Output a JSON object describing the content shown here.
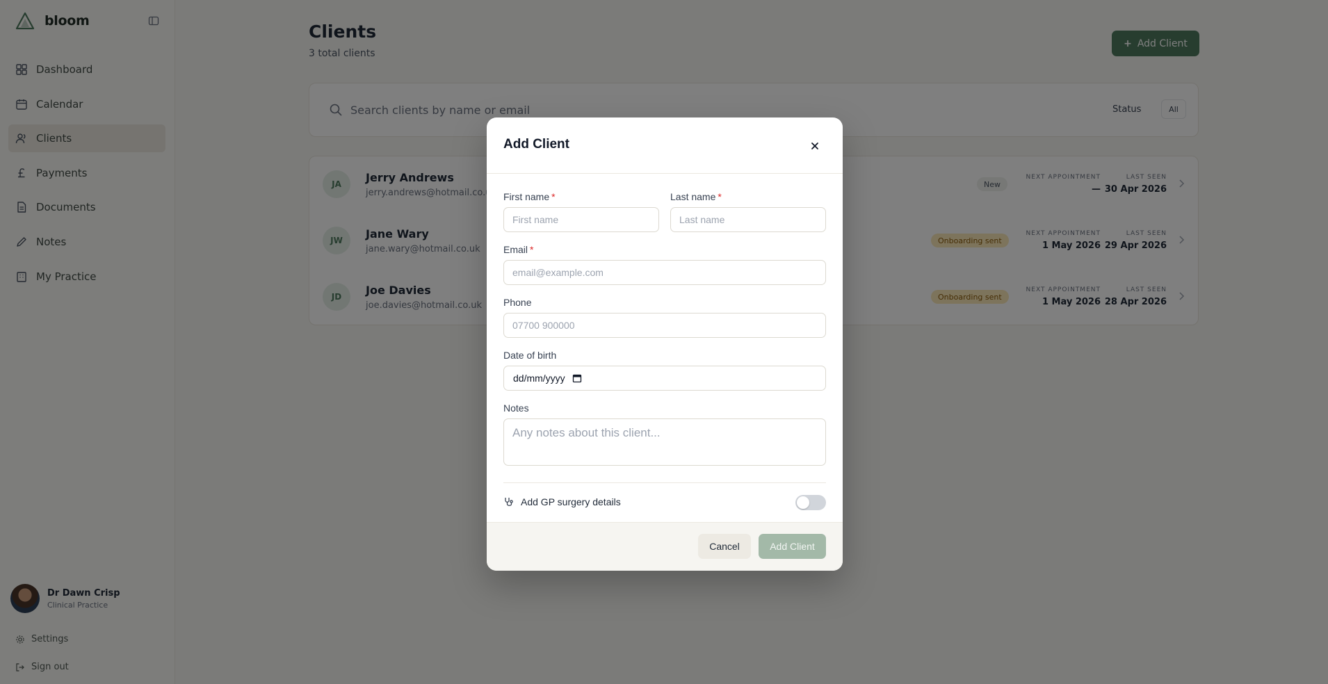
{
  "brand": {
    "name": "bloom"
  },
  "sidebar": {
    "items": [
      {
        "label": "Dashboard",
        "icon": "grid-icon"
      },
      {
        "label": "Calendar",
        "icon": "calendar-icon"
      },
      {
        "label": "Clients",
        "icon": "users-icon",
        "active": true
      },
      {
        "label": "Payments",
        "icon": "pound-icon"
      },
      {
        "label": "Documents",
        "icon": "document-icon"
      },
      {
        "label": "Notes",
        "icon": "notes-icon"
      },
      {
        "label": "My Practice",
        "icon": "building-icon"
      }
    ],
    "user": {
      "name": "Dr Dawn Crisp",
      "role": "Clinical Practice"
    },
    "settings_label": "Settings",
    "signout_label": "Sign out"
  },
  "page": {
    "title": "Clients",
    "subtitle": "3 total clients",
    "add_button": "Add Client"
  },
  "search": {
    "placeholder": "Search clients by name or email",
    "status_label": "Status",
    "status_value": "All"
  },
  "clients": [
    {
      "initials": "JA",
      "name": "Jerry Andrews",
      "email": "jerry.andrews@hotmail.co.uk",
      "badge": "New",
      "badge_type": "new",
      "next_label": "NEXT APPOINTMENT",
      "next_value": "—",
      "last_label": "LAST SEEN",
      "last_value": "30 Apr 2026"
    },
    {
      "initials": "JW",
      "name": "Jane Wary",
      "email": "jane.wary@hotmail.co.uk",
      "badge": "Onboarding sent",
      "badge_type": "onb",
      "next_label": "NEXT APPOINTMENT",
      "next_value": "1 May 2026",
      "last_label": "LAST SEEN",
      "last_value": "29 Apr 2026"
    },
    {
      "initials": "JD",
      "name": "Joe Davies",
      "email": "joe.davies@hotmail.co.uk",
      "badge": "Onboarding sent",
      "badge_type": "onb",
      "next_label": "NEXT APPOINTMENT",
      "next_value": "1 May 2026",
      "last_label": "LAST SEEN",
      "last_value": "28 Apr 2026"
    }
  ],
  "modal": {
    "title": "Add Client",
    "first_name": {
      "label": "First name",
      "required_mark": "*",
      "placeholder": "First name"
    },
    "last_name": {
      "label": "Last name",
      "required_mark": "*",
      "placeholder": "Last name"
    },
    "email": {
      "label": "Email",
      "required_mark": "*",
      "placeholder": "email@example.com"
    },
    "phone": {
      "label": "Phone",
      "placeholder": "07700 900000"
    },
    "dob": {
      "label": "Date of birth",
      "placeholder": "dd/mm/yyyy"
    },
    "notes": {
      "label": "Notes",
      "placeholder": "Any notes about this client..."
    },
    "gp": {
      "label": "Add GP surgery details",
      "enabled": false
    },
    "cancel_label": "Cancel",
    "submit_label": "Add Client"
  },
  "colors": {
    "accent": "#4f7a5e",
    "accent_disabled": "#a3b9a8",
    "required": "#dc2626",
    "badge_onboarding": "#fbe8b8"
  }
}
